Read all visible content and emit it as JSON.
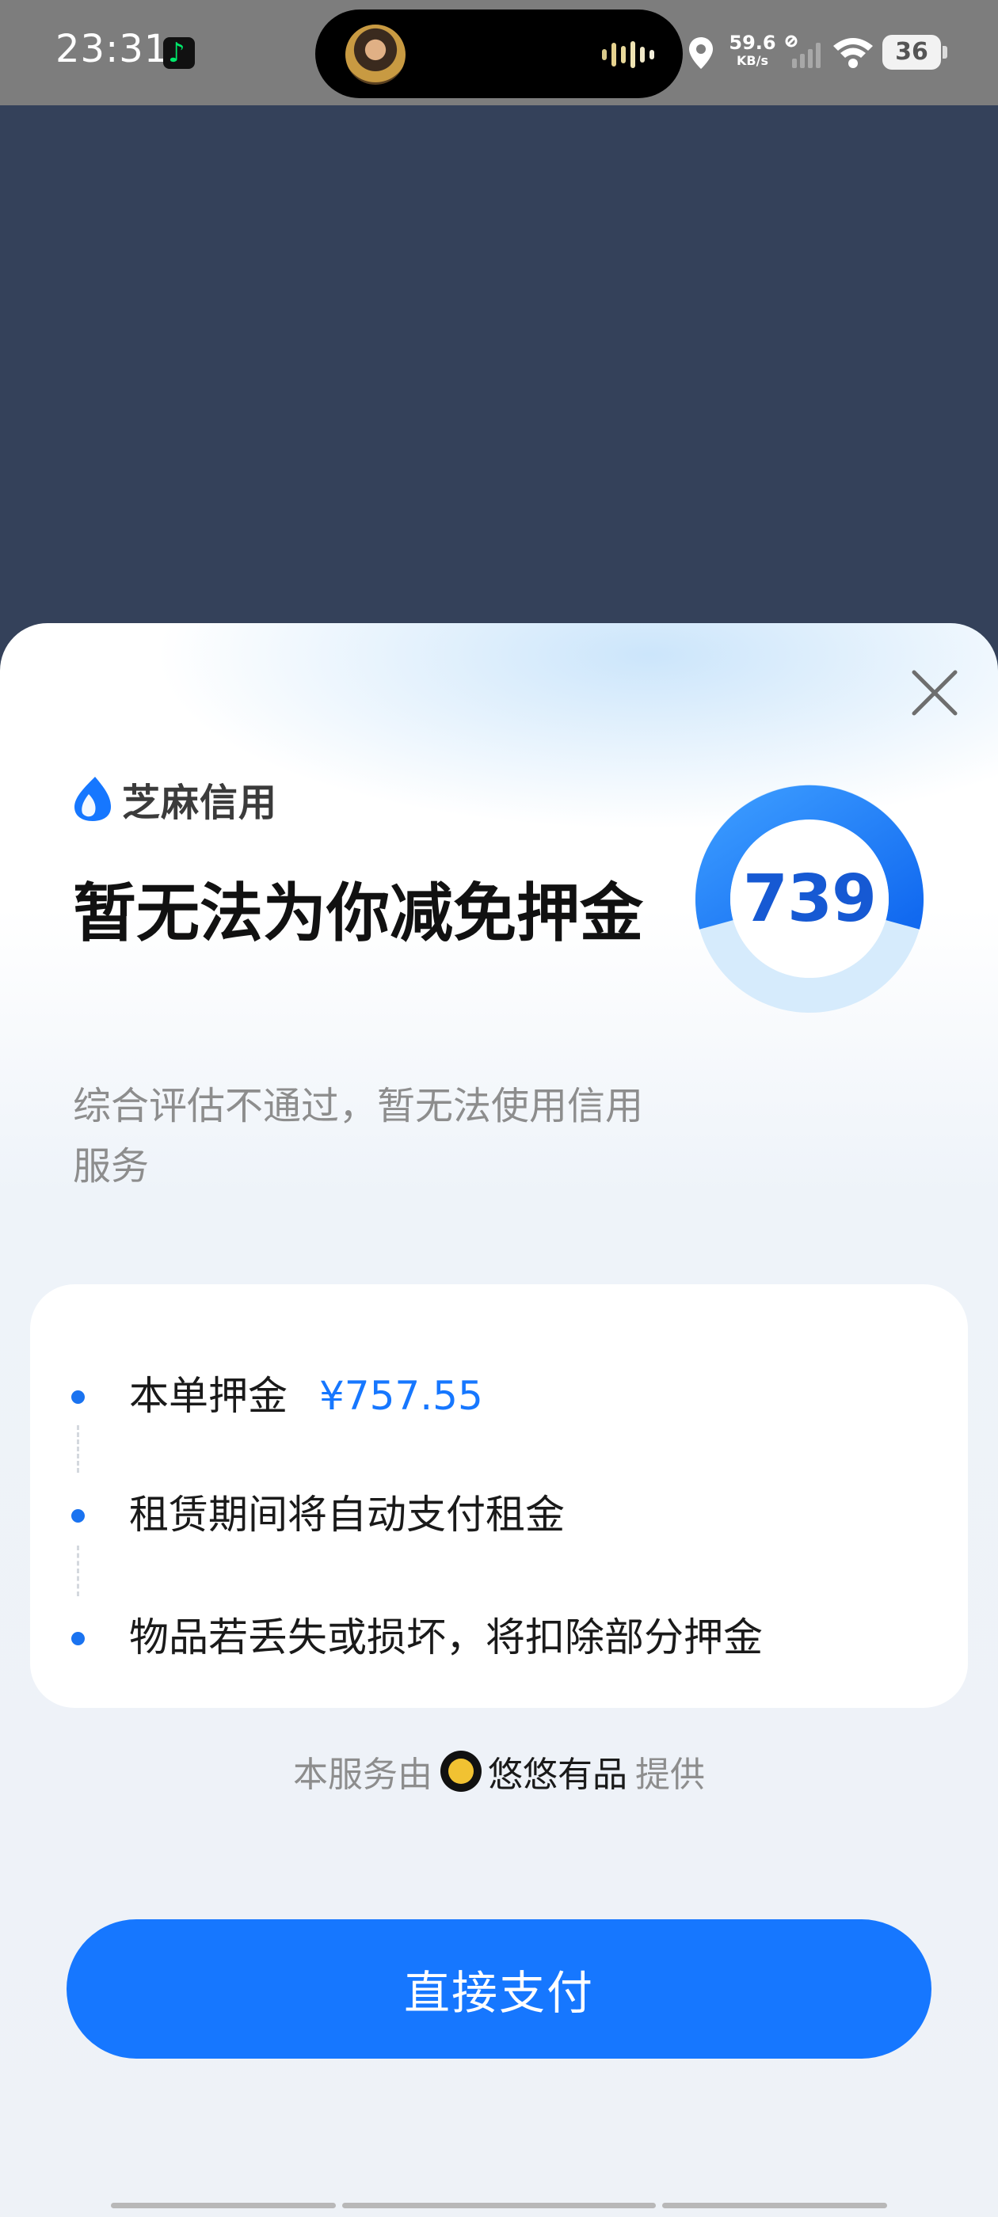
{
  "status_bar": {
    "time": "23:31",
    "net_speed_value": "59.6",
    "net_speed_unit": "KB/s",
    "battery_level": "36"
  },
  "sheet": {
    "brand_name": "芝麻信用",
    "headline": "暂无法为你减免押金",
    "subtitle": "综合评估不通过，暂无法使用信用服务",
    "credit_score": "739",
    "info_items": [
      {
        "label": "本单押金",
        "amount": "¥757.55"
      },
      {
        "label": "租赁期间将自动支付租金"
      },
      {
        "label": "物品若丢失或损坏，将扣除部分押金"
      }
    ],
    "provider": {
      "prefix": "本服务由",
      "name": "悠悠有品",
      "suffix": "提供"
    },
    "pay_button_label": "直接支付"
  },
  "colors": {
    "accent": "#1677ff",
    "score_text": "#1659d3",
    "backdrop": "#34415a"
  },
  "icons": [
    "music-app-icon",
    "location-icon",
    "signal-icon",
    "wifi-icon",
    "battery-icon",
    "close-icon",
    "zhima-logo-icon",
    "provider-logo-icon"
  ]
}
